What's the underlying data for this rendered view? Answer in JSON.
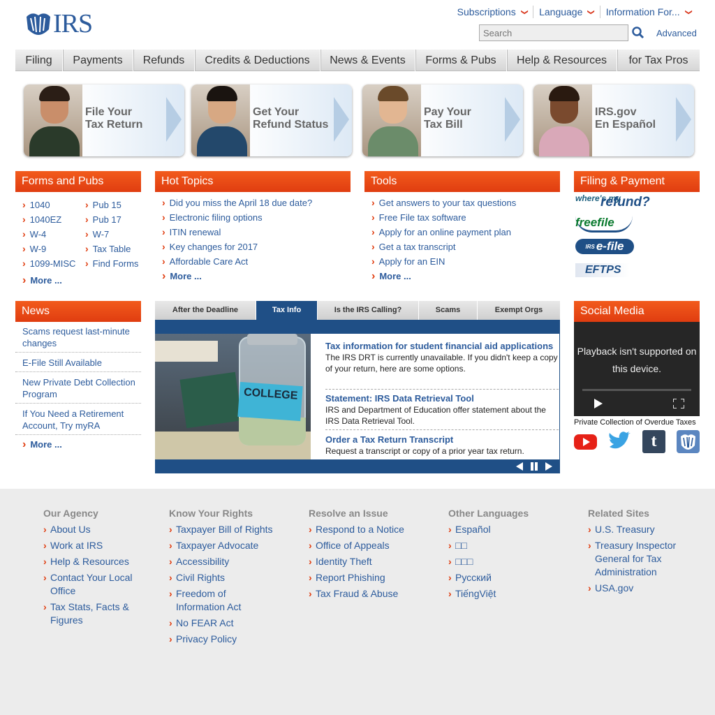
{
  "header": {
    "logo_text": "IRS",
    "top_links": [
      "Subscriptions",
      "Language",
      "Information For..."
    ],
    "search_placeholder": "Search",
    "advanced_label": "Advanced"
  },
  "nav": [
    "Filing",
    "Payments",
    "Refunds",
    "Credits & Deductions",
    "News & Events",
    "Forms & Pubs",
    "Help & Resources",
    "for Tax Pros"
  ],
  "promos": [
    {
      "line1": "File Your",
      "line2": "Tax Return"
    },
    {
      "line1": "Get Your",
      "line2": "Refund Status"
    },
    {
      "line1": "Pay Your",
      "line2": "Tax Bill"
    },
    {
      "line1": "IRS.gov",
      "line2": "En Español"
    }
  ],
  "forms_pubs": {
    "title": "Forms and Pubs",
    "col1": [
      "1040",
      "1040EZ",
      "W-4",
      "W-9",
      "1099-MISC"
    ],
    "col2": [
      "Pub 15",
      "Pub 17",
      "W-7",
      "Tax Table",
      "Find Forms"
    ],
    "more": "More ..."
  },
  "hot_topics": {
    "title": "Hot Topics",
    "items": [
      "Did you miss the April 18 due date?",
      "Electronic filing options",
      "ITIN renewal",
      "Key changes for 2017",
      "Affordable Care Act"
    ],
    "more": "More ..."
  },
  "tools": {
    "title": "Tools",
    "items": [
      "Get answers to your tax questions",
      "Free File tax software",
      "Apply for an online payment plan",
      "Get a tax transcript",
      "Apply for an EIN"
    ],
    "more": "More ..."
  },
  "filing_payment": {
    "title": "Filing & Payment",
    "logos": [
      "where's my refund?",
      "freefile",
      "e-file",
      "EFTPS"
    ],
    "refund_small": "where's my",
    "refund_big": "refund?",
    "freefile": "freefile",
    "efile": "e-file",
    "efile_prefix": "IRS",
    "eftps": "EFTPS"
  },
  "news": {
    "title": "News",
    "items": [
      "Scams request last-minute changes",
      "E-File Still Available",
      "New Private Debt Collection Program",
      "If You Need a Retirement Account, Try myRA"
    ],
    "more": "More ..."
  },
  "tabs": [
    "After the Deadline",
    "Tax Info",
    "Is the IRS Calling?",
    "Scams",
    "Exempt Orgs"
  ],
  "tax_info": [
    {
      "title": "Tax information for student financial aid applications",
      "body": "The IRS DRT is currently unavailable. If you didn't keep a copy of your return, here are some options."
    },
    {
      "title": "Statement: IRS Data Retrieval Tool",
      "body": "IRS and Department of Education offer statement about the IRS Data Retrieval Tool."
    },
    {
      "title": "Order a Tax Return Transcript",
      "body": "Request a transcript or copy of a prior year tax return."
    }
  ],
  "jar_label": "COLLEGE",
  "social": {
    "title": "Social Media",
    "video_message": "Playback isn't supported on this device.",
    "video_caption": "Private Collection of Overdue Taxes",
    "icons": [
      "youtube-icon",
      "twitter-icon",
      "tumblr-icon",
      "irs-seal-icon"
    ],
    "tumblr_glyph": "t"
  },
  "footer": [
    {
      "heading": "Our Agency",
      "links": [
        "About Us",
        "Work at IRS",
        "Help & Resources",
        "Contact Your Local Office",
        "Tax Stats, Facts & Figures"
      ]
    },
    {
      "heading": "Know Your Rights",
      "links": [
        "Taxpayer Bill of Rights",
        "Taxpayer Advocate",
        "Accessibility",
        "Civil Rights",
        "Freedom of Information Act",
        "No FEAR Act",
        "Privacy Policy"
      ]
    },
    {
      "heading": "Resolve an Issue",
      "links": [
        "Respond to a Notice",
        "Office of Appeals",
        "Identity Theft",
        "Report Phishing",
        "Tax Fraud & Abuse"
      ]
    },
    {
      "heading": "Other Languages",
      "links": [
        "Español",
        "□□",
        "□□□",
        "Русский",
        "TiếngViệt"
      ]
    },
    {
      "heading": "Related Sites",
      "links": [
        "U.S. Treasury",
        "Treasury Inspector General for Tax Administration",
        "USA.gov"
      ]
    }
  ],
  "colors": {
    "brand_blue": "#2c5b9c",
    "accent_orange": "#e03d10",
    "tab_blue": "#1f4f86"
  }
}
